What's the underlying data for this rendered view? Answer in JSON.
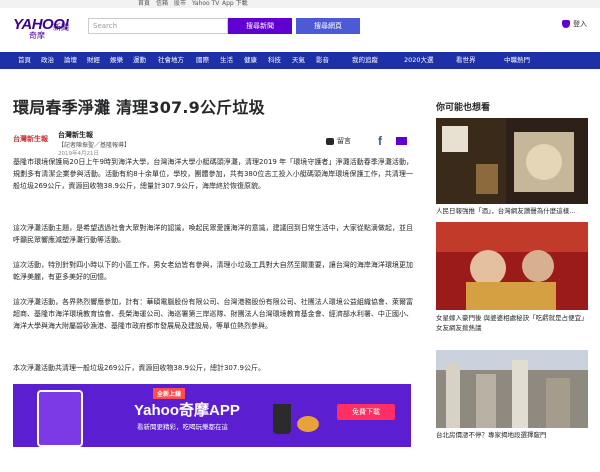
{
  "topbar": {
    "links": [
      "首頁",
      "信箱",
      "股市",
      "Yahoo TV",
      "App 下載"
    ]
  },
  "header": {
    "logo_text": "YAHOO!",
    "logo_sub1": "奇摩",
    "logo_sub2": "新聞",
    "search_placeholder": "Search",
    "search_button_1": "搜尋新聞",
    "search_button_2": "搜尋網頁",
    "login_label": "登入"
  },
  "nav": {
    "items": [
      "首頁",
      "政治",
      "論壇",
      "財經",
      "娛樂",
      "運動",
      "社會地方",
      "國際",
      "生活",
      "健康",
      "科技",
      "天氣",
      "影音",
      "我的追蹤",
      "2020大選",
      "看世界",
      "中職熱門"
    ]
  },
  "article": {
    "title": "環局春季淨灘 清理307.9公斤垃圾",
    "source_logo": "台灣新生報",
    "source_name": "台灣新生報",
    "author": "【記者陳振聖／基隆報導】",
    "date": "2019年4月21日",
    "comment_label": "留言",
    "paragraphs": [
      "基隆市環境保護局20日上午9時到海洋大學，台灣海洋大學小艇碼頭淨灘，清理2019 年「環境守護者」淨灘活動春季淨灘活動，規劃多有清潔企業參與活動。活動有約8十余單位，學校，團體參加，共有380位志工投入小艇碼頭海岸環境保護工作，共清理一般垃圾269公斤，資源回收物38.9公斤，總量計307.9公斤，海岸終於恢復原貌。",
      "這次淨灘活動主題，是希望透過社會大眾對海洋的認識，喚起民眾愛護海洋的意識，建議回到日常生活中，大家從點滴做起，並且呼籲民眾響應減塑淨灘行動等活動。",
      "這次活動，特別針對四小時以下的小區工作，男女老幼皆有參與，清理小垃圾工具對大自然至關重要，讓台灣的海岸海洋環境更加乾淨美麗，有更多美好的回憶。",
      "這次淨灘活動，各界熱烈響應參加，計有：華碩電腦股份有限公司、台灣港務股份有限公司、社團法人環境公益組織協會、萊爾富超商、基隆市海洋環境教育協會、長榮海運公司、海巡署第三岸巡隊、財團法人台灣環境教育基金會、經濟部水利署、中正國小、海洋大學與海大附屬碧砂漁港、基隆市政府都市發展局及建設局，等單位熱烈參與。",
      "本次淨灘活動共清理一般垃圾269公斤，資源回收物38.9公斤，總計307.9公斤。"
    ]
  },
  "ad": {
    "tag": "全新上線",
    "brand": "Yahoo奇摩APP",
    "slogan": "看新聞更精彩，吃喝玩樂都在這",
    "cta": "免費下載"
  },
  "sidebar": {
    "title": "你可能也想看",
    "items": [
      {
        "caption": "人民日報強推「酒」，台灣網友讚聲為什麼這樣…"
      },
      {
        "caption": "女星嫁入豪門後 與婆婆相處秘訣「吃虧就是占便宜」 女友網友掀熱議"
      },
      {
        "caption": "台北房價漲不停？專家揭地段選擇竅門"
      }
    ]
  },
  "colors": {
    "nav_bg": "#1e30a8",
    "brand_purple": "#6001d2",
    "ad_bg": "#5b1fd1",
    "cta_red": "#ff2e63"
  }
}
